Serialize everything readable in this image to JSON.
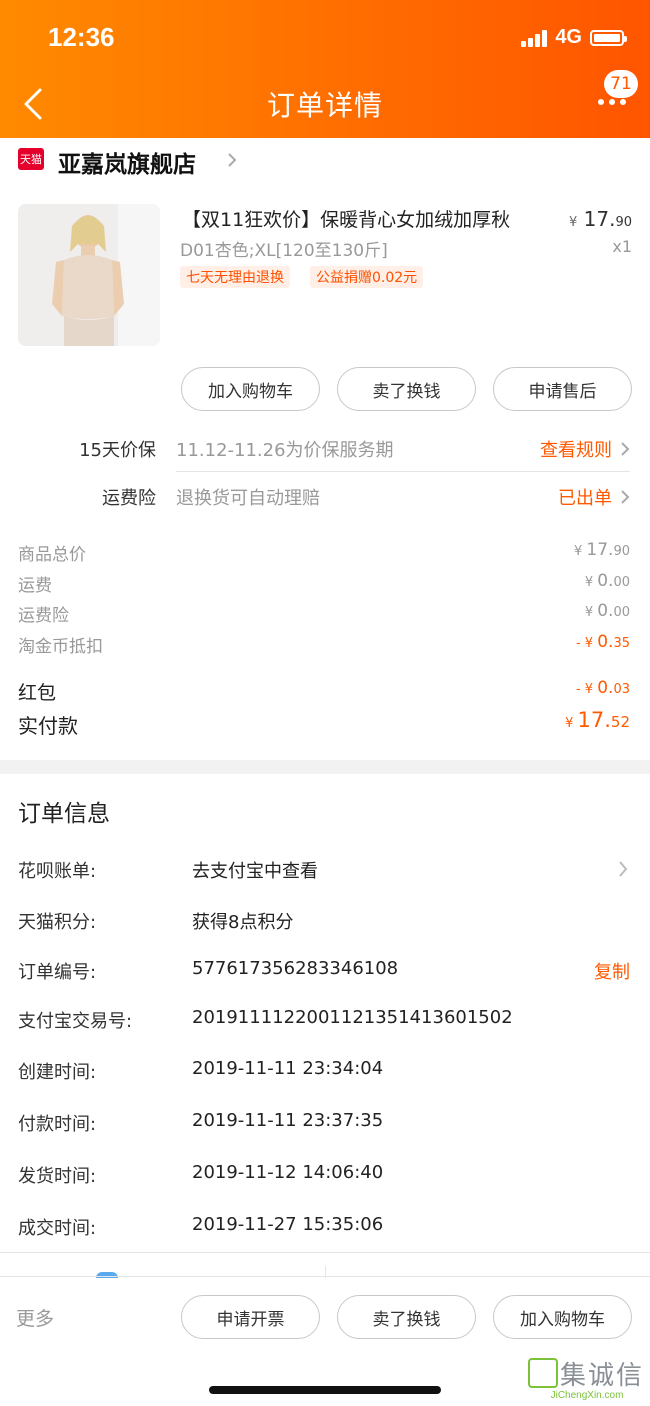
{
  "status_bar": {
    "time": "12:36",
    "network": "4G"
  },
  "header": {
    "title": "订单详情",
    "badge_count": "71"
  },
  "store": {
    "logo_text": "天猫",
    "name": "亚嘉岚旗舰店"
  },
  "product": {
    "title": "【双11狂欢价】保暖背心女加绒加厚秋",
    "sku": "D01杏色;XL[120至130斤]",
    "price_symbol": "¥",
    "price_int": "17.",
    "price_dec": "90",
    "qty": "x1",
    "tags": [
      "七天无理由退换",
      "公益捐赠0.02元"
    ]
  },
  "product_actions": [
    "加入购物车",
    "卖了换钱",
    "申请售后"
  ],
  "services": [
    {
      "label": "15天价保",
      "desc": "11.12-11.26为价保服务期",
      "action": "查看规则"
    },
    {
      "label": "运费险",
      "desc": "退换货可自动理赔",
      "action": "已出单"
    }
  ],
  "summary": [
    {
      "label": "商品总价",
      "prefix": "¥ ",
      "int": "17.",
      "dec": "90",
      "red": false
    },
    {
      "label": "运费",
      "prefix": "¥ ",
      "int": "0.",
      "dec": "00",
      "red": false
    },
    {
      "label": "运费险",
      "prefix": "¥ ",
      "int": "0.",
      "dec": "00",
      "red": false
    },
    {
      "label": "淘金币抵扣",
      "prefix": "- ¥ ",
      "int": "0.",
      "dec": "35",
      "red": true
    },
    {
      "label": "红包",
      "prefix": "- ¥ ",
      "int": "0.",
      "dec": "03",
      "red": true
    }
  ],
  "total": {
    "label": "实付款",
    "prefix": "¥ ",
    "int": "17.",
    "dec": "52"
  },
  "order_info": {
    "title": "订单信息",
    "rows": [
      {
        "label": "花呗账单:",
        "value": "去支付宝中查看"
      },
      {
        "label": "天猫积分:",
        "value": "获得8点积分"
      },
      {
        "label": "订单编号:",
        "value": "577617356283346108"
      },
      {
        "label": "支付宝交易号:",
        "value": "2019111122001121351413601502"
      },
      {
        "label": "创建时间:",
        "value": "2019-11-11 23:34:04"
      },
      {
        "label": "付款时间:",
        "value": "2019-11-11 23:37:35"
      },
      {
        "label": "发货时间:",
        "value": "2019-11-12 14:06:40"
      },
      {
        "label": "成交时间:",
        "value": "2019-11-27 15:35:06"
      }
    ],
    "copy_label": "复制"
  },
  "bottom_bar": {
    "more": "更多",
    "buttons": [
      "申请开票",
      "卖了换钱",
      "加入购物车"
    ]
  },
  "watermark": {
    "text": "集诚信",
    "sub": "JiChengXin.com"
  },
  "colors": {
    "accent": "#ff5a00",
    "header_start": "#ff8a00",
    "header_end": "#ff5500"
  }
}
